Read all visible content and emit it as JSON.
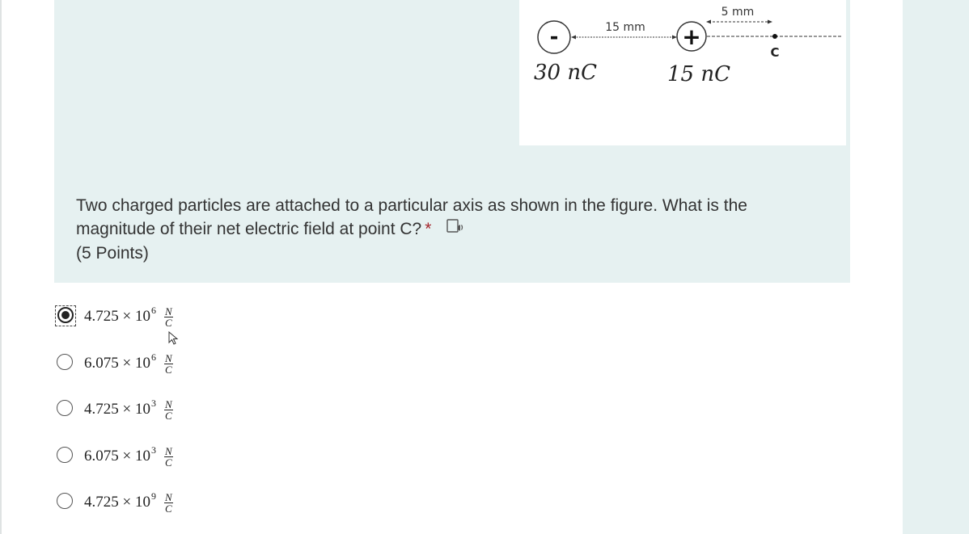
{
  "figure": {
    "left_charge_sign": "-",
    "right_charge_sign": "+",
    "distance_between": "15 mm",
    "distance_to_c": "5 mm",
    "point_label": "C",
    "left_charge": "30 nC",
    "right_charge": "15 nC"
  },
  "question": {
    "text_line1": "Two charged particles are attached to a particular axis as shown in the figure. What is the",
    "text_line2": "magnitude of their net electric field at point C?",
    "required_mark": "*",
    "points": "(5 Points)",
    "tts_icon": "immersive-reader-icon"
  },
  "options": [
    {
      "mantissa": "4.725",
      "times": "×",
      "base": "10",
      "exponent": "6",
      "unit_num": "N",
      "unit_den": "C",
      "selected": true
    },
    {
      "mantissa": "6.075",
      "times": "×",
      "base": "10",
      "exponent": "6",
      "unit_num": "N",
      "unit_den": "C",
      "selected": false
    },
    {
      "mantissa": "4.725",
      "times": "×",
      "base": "10",
      "exponent": "3",
      "unit_num": "N",
      "unit_den": "C",
      "selected": false
    },
    {
      "mantissa": "6.075",
      "times": "×",
      "base": "10",
      "exponent": "3",
      "unit_num": "N",
      "unit_den": "C",
      "selected": false
    },
    {
      "mantissa": "4.725",
      "times": "×",
      "base": "10",
      "exponent": "9",
      "unit_num": "N",
      "unit_den": "C",
      "selected": false
    }
  ]
}
